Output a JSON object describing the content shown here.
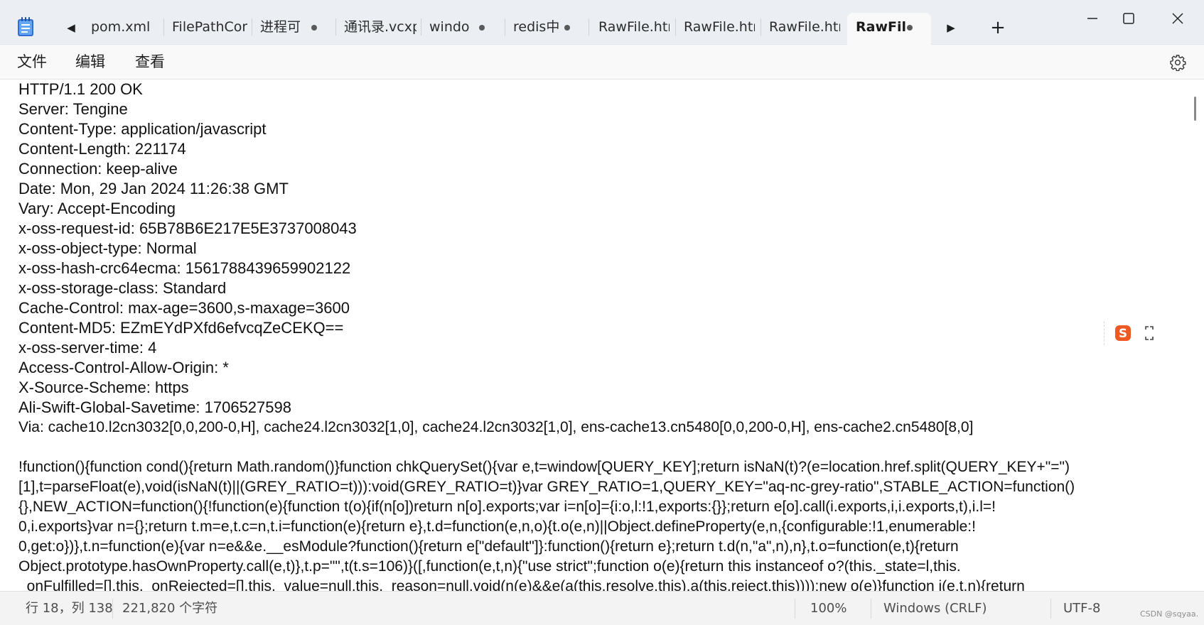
{
  "tabs": [
    {
      "label": "pom.xml",
      "modified": false,
      "active": false
    },
    {
      "label": "FilePathConf",
      "modified": false,
      "active": false
    },
    {
      "label": "进程可",
      "modified": true,
      "active": false
    },
    {
      "label": "通讯录.vcxpr",
      "modified": false,
      "active": false
    },
    {
      "label": "windo",
      "modified": true,
      "active": false
    },
    {
      "label": "redis中",
      "modified": true,
      "active": false
    },
    {
      "label": "RawFile.htm",
      "modified": false,
      "active": false
    },
    {
      "label": "RawFile.htm",
      "modified": false,
      "active": false
    },
    {
      "label": "RawFile.htm",
      "modified": false,
      "active": false
    },
    {
      "label": "RawFil",
      "modified": true,
      "active": true
    }
  ],
  "tab_controls": {
    "scroll_left": "◀",
    "scroll_right": "▶",
    "add": "+"
  },
  "menu": {
    "file": "文件",
    "edit": "编辑",
    "view": "查看"
  },
  "editor": {
    "lines": [
      "HTTP/1.1 200 OK",
      "Server: Tengine",
      "Content-Type: application/javascript",
      "Content-Length: 221174",
      "Connection: keep-alive",
      "Date: Mon, 29 Jan 2024 11:26:38 GMT",
      "Vary: Accept-Encoding",
      "x-oss-request-id: 65B78B6E217E5E3737008043",
      "x-oss-object-type: Normal",
      "x-oss-hash-crc64ecma: 1561788439659902122",
      "x-oss-storage-class: Standard",
      "Cache-Control: max-age=3600,s-maxage=3600",
      "Content-MD5: EZmEYdPXfd6efvcqZeCEKQ==",
      "x-oss-server-time: 4",
      "Access-Control-Allow-Origin: *",
      "X-Source-Scheme: https",
      "Ali-Swift-Global-Savetime: 1706527598",
      "Via: cache10.l2cn3032[0,0,200-0,H], cache24.l2cn3032[1,0], cache24.l2cn3032[1,0], ens-cache13.cn5480[0,0,200-0,H], ens-cache2.cn5480[8,0]",
      "",
      "!function(){function cond(){return Math.random()}function chkQuerySet(){var e,t=window[QUERY_KEY];return isNaN(t)?(e=location.href.split(QUERY_KEY+\"=\")",
      "[1],t=parseFloat(e),void(isNaN(t)||(GREY_RATIO=t))):void(GREY_RATIO=t)}var GREY_RATIO=1,QUERY_KEY=\"aq-nc-grey-ratio\",STABLE_ACTION=function()",
      "{},NEW_ACTION=function(){!function(e){function t(o){if(n[o])return n[o].exports;var i=n[o]={i:o,l:!1,exports:{}};return e[o].call(i.exports,i,i.exports,t),i.l=!",
      "0,i.exports}var n={};return t.m=e,t.c=n,t.i=function(e){return e},t.d=function(e,n,o){t.o(e,n)||Object.defineProperty(e,n,{configurable:!1,enumerable:!",
      "0,get:o})},t.n=function(e){var n=e&&e.__esModule?function(){return e[\"default\"]}:function(){return e};return t.d(n,\"a\",n),n},t.o=function(e,t){return",
      "Object.prototype.hasOwnProperty.call(e,t)},t.p=\"\",t(t.s=106)}([,function(e,t,n){\"use strict\";function o(e){return this instanceof o?(this._state=l,this.",
      "_onFulfilled=[],this._onRejected=[],this._value=null,this._reason=null,void(n(e)&&e(a(this.resolve,this),a(this.reject,this)))):new o(e)}function i(e,t,n){return"
    ]
  },
  "status": {
    "position": "行 18，列 138",
    "char_count": "221,820 个字符",
    "zoom": "100%",
    "line_ending": "Windows (CRLF)",
    "encoding": "UTF-8"
  },
  "watermark": "CSDN @sqyaa."
}
